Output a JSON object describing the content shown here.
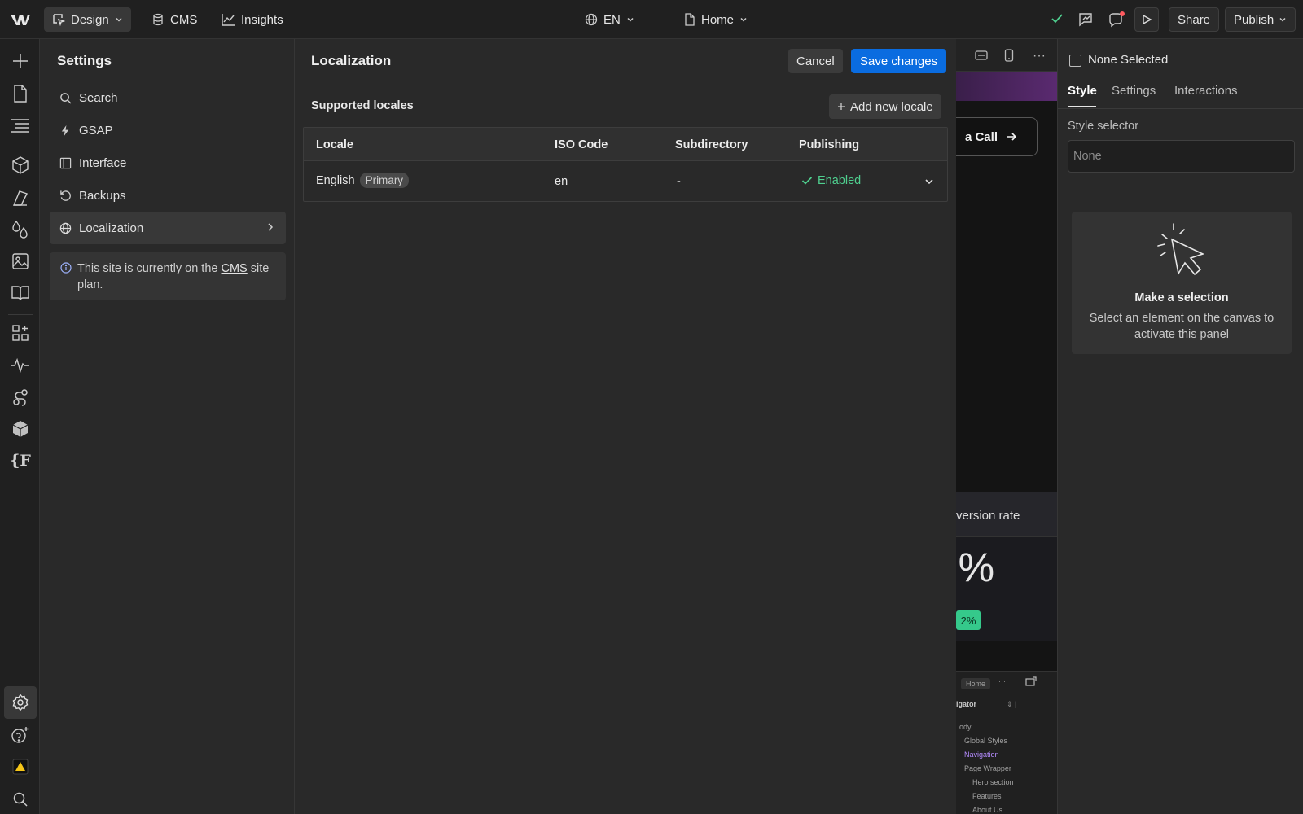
{
  "topbar": {
    "design_label": "Design",
    "cms_label": "CMS",
    "insights_label": "Insights",
    "locale_label": "EN",
    "page_label": "Home",
    "share_label": "Share",
    "publish_label": "Publish"
  },
  "settings": {
    "title": "Settings",
    "items": [
      {
        "label": "Search",
        "icon": "search-icon"
      },
      {
        "label": "GSAP",
        "icon": "bolt-icon"
      },
      {
        "label": "Interface",
        "icon": "panel-icon"
      },
      {
        "label": "Backups",
        "icon": "restore-icon"
      },
      {
        "label": "Localization",
        "icon": "globe-icon"
      }
    ],
    "info_prefix": "This site is currently on the",
    "info_link": "CMS",
    "info_suffix": "site plan."
  },
  "localization": {
    "title": "Localization",
    "cancel_label": "Cancel",
    "save_label": "Save changes",
    "supported_title": "Supported locales",
    "add_label": "Add new locale",
    "columns": [
      "Locale",
      "ISO Code",
      "Subdirectory",
      "Publishing"
    ],
    "rows": [
      {
        "locale": "English",
        "badge": "Primary",
        "iso": "en",
        "subdirectory": "-",
        "publishing": "Enabled"
      }
    ]
  },
  "canvas": {
    "cta_text": "a Call",
    "conversion_text": "version rate",
    "big_text": "%",
    "badge_text": "2%",
    "mini": {
      "home_label": "Home",
      "navigator_label": "igator",
      "items": [
        "ody",
        "Global Styles",
        "Navigation",
        "Page Wrapper",
        "Hero section",
        "Features",
        "About Us"
      ]
    }
  },
  "right_panel": {
    "none_selected": "None Selected",
    "tabs": [
      "Style",
      "Settings",
      "Interactions"
    ],
    "style_selector_label": "Style selector",
    "style_selector_placeholder": "None",
    "empty_title": "Make a selection",
    "empty_text": "Select an element on the canvas to activate this panel"
  },
  "colors": {
    "accent_blue": "#0a6ce0",
    "enabled_green": "#4fcf8f",
    "warning_yellow": "#f5c518",
    "notification_red": "#ff5a5f"
  }
}
